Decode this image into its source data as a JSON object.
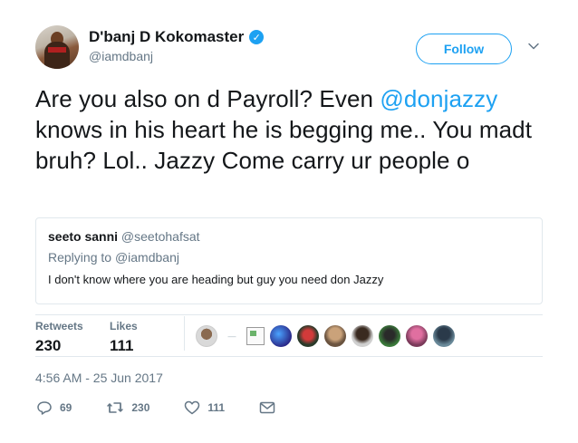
{
  "author": {
    "display_name": "D'banj D Kokomaster",
    "handle": "@iamdbanj",
    "verified_mark": "✓"
  },
  "follow_label": "Follow",
  "tweet": {
    "text_before": "Are you also on d Payroll? Even ",
    "mention": "@donjazzy",
    "text_after": " knows in his heart he is begging me.. You madt bruh? Lol.. Jazzy Come carry ur people o"
  },
  "quote": {
    "name": "seeto sanni",
    "handle": "@seetohafsat",
    "replying_prefix": "Replying to ",
    "replying_handle": "@iamdbanj",
    "text": "I don't know where you are heading but guy you need don Jazzy"
  },
  "stats": {
    "retweets_label": "Retweets",
    "retweets_value": "230",
    "likes_label": "Likes",
    "likes_value": "111"
  },
  "likers_dash": "—",
  "timestamp": "4:56 AM - 25 Jun 2017",
  "actions": {
    "replies": "69",
    "retweets": "230",
    "likes": "111"
  },
  "colors": {
    "accent": "#1da1f2",
    "text": "#14171a",
    "muted": "#657786",
    "border": "#e1e8ed"
  }
}
